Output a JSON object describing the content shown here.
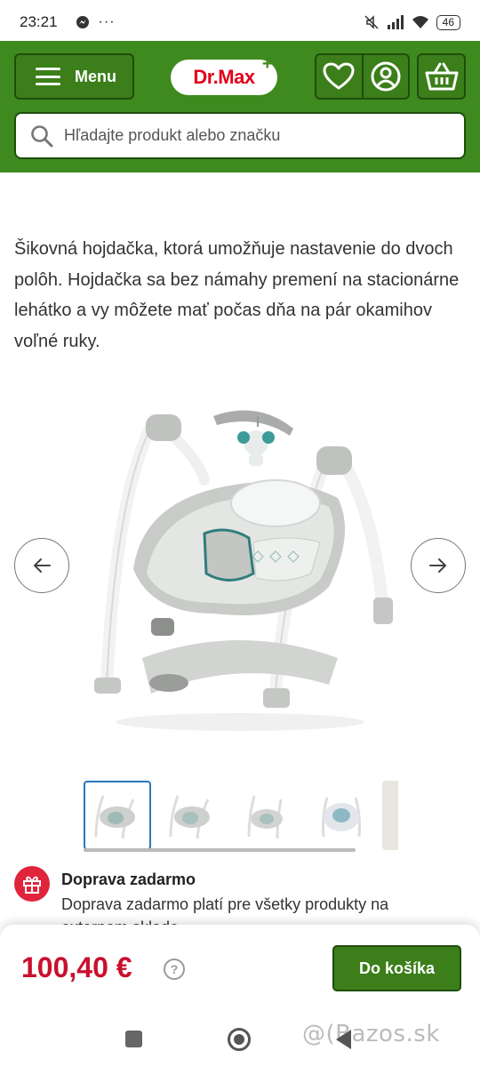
{
  "status_bar": {
    "time": "23:21",
    "battery": "46",
    "icons": [
      "messenger-icon",
      "more-dots-icon",
      "mute-icon",
      "signal-icon",
      "wifi-icon",
      "battery-icon"
    ]
  },
  "header": {
    "menu_label": "Menu",
    "logo_text": "Dr.Max",
    "logo_plus": "+",
    "search_placeholder": "Hľadajte produkt alebo značku",
    "colors": {
      "brand_green": "#3f8a1e",
      "logo_red": "#e2001a"
    }
  },
  "description": "Šikovná hojdačka, ktorá umožňuje nastavenie do dvoch polôh. Hojdačka sa bez námahy premení na stacionárne lehátko a vy môžete mať počas dňa na pár okamihov voľné ruky.",
  "gallery": {
    "thumbnail_count_visible": 5,
    "active_index": 0
  },
  "shipping": {
    "title": "Doprava zadarmo",
    "text": "Doprava zadarmo platí pre všetky produkty na externom sklade"
  },
  "buy_bar": {
    "price": "100,40 €",
    "help_symbol": "?",
    "add_to_cart_label": "Do košíka",
    "price_color": "#c8102e"
  },
  "watermark": "@(Bazos.sk"
}
